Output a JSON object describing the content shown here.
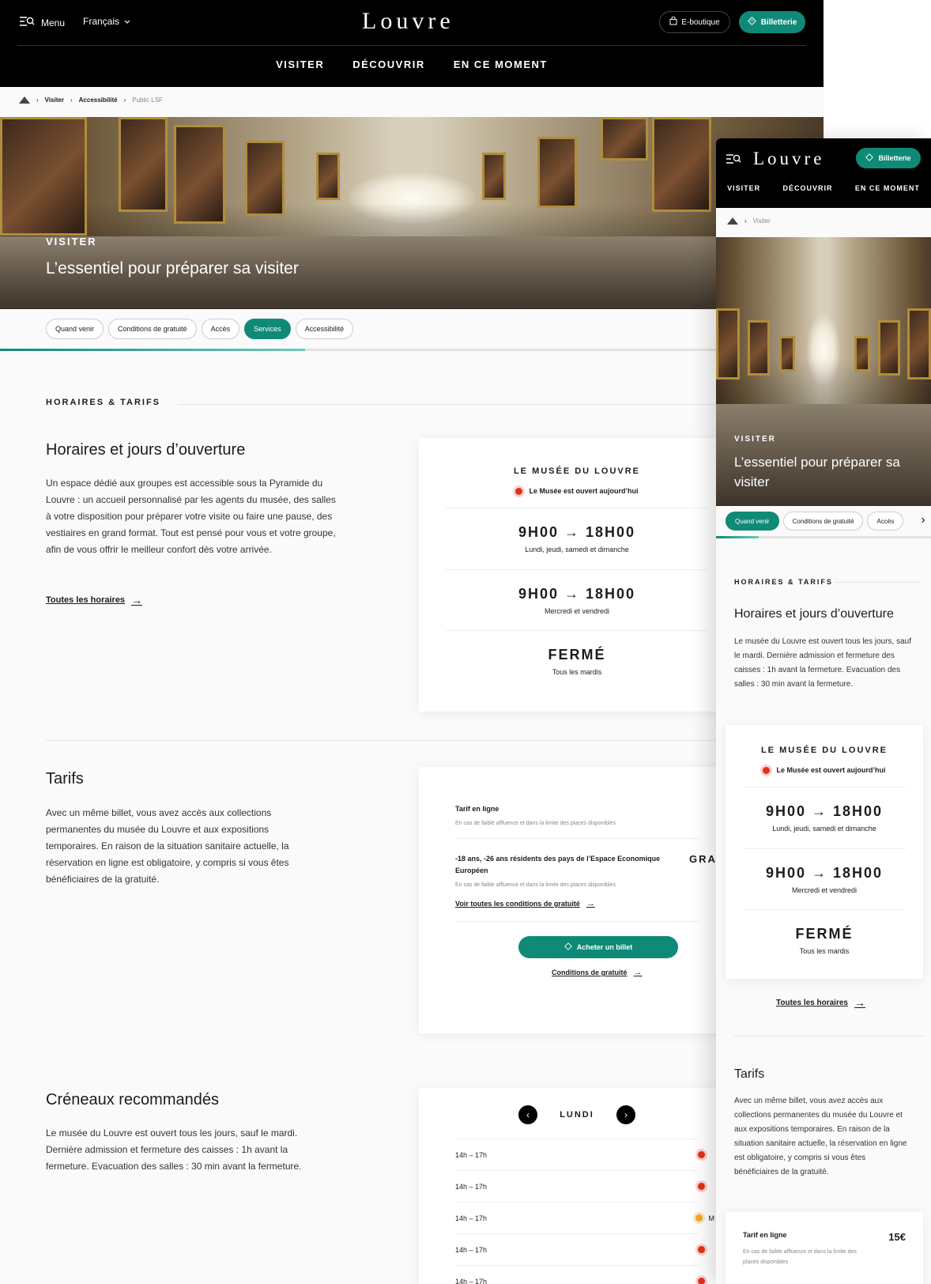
{
  "desktop": {
    "header": {
      "menu": "Menu",
      "language": "Français",
      "logo": "Louvre",
      "shop": "E-boutique",
      "tickets": "Billetterie"
    },
    "nav": [
      "VISITER",
      "DÉCOUVRIR",
      "EN CE MOMENT"
    ],
    "breadcrumb": {
      "items": [
        "Visiter",
        "Accessibilité"
      ],
      "current": "Public LSF"
    },
    "hero": {
      "eyebrow": "VISITER",
      "title": "L’essentiel pour préparer sa visiter"
    },
    "tabs": [
      {
        "label": "Quand venir",
        "active": false
      },
      {
        "label": "Conditions de gratuité",
        "active": false
      },
      {
        "label": "Accès",
        "active": false
      },
      {
        "label": "Services",
        "active": true
      },
      {
        "label": "Accessibilité",
        "active": false
      }
    ],
    "tabs_progress": 0.37,
    "section_title": "HORAIRES & TARIFS",
    "horaires": {
      "title": "Horaires et jours d’ouverture",
      "text": "Un espace dédié aux groupes est accessible sous la Pyramide du Louvre : un accueil personnalisé par les agents du musée, des salles à votre disposition pour préparer votre visite ou faire une pause, des vestiaires en grand format. Tout est pensé pour vous et votre groupe, afin de vous offrir le meilleur confort dès votre arrivée.",
      "link": "Toutes les horaires"
    },
    "museum_card": {
      "title": "LE MUSÉE DU LOUVRE",
      "status": "Le Musée est ouvert aujourd’hui",
      "rows": [
        {
          "time": "9H00 → 18H00",
          "days": "Lundi, jeudi, samedi et dimanche"
        },
        {
          "time": "9H00 → 18H00",
          "days": "Mercredi et vendredi"
        },
        {
          "time": "FERMÉ",
          "days": "Tous les mardis"
        }
      ]
    },
    "tarifs": {
      "title": "Tarifs",
      "text": "Avec un même billet, vous avez accès aux collections permanentes du musée du Louvre et aux expositions temporaires. En raison de la situation sanitaire actuelle, la réservation en ligne est obligatoire, y compris si vous êtes bénéficiaires de la gratuité.",
      "rows": [
        {
          "label": "Tarif en ligne",
          "sub": "En cas de faible affluence et dans la limite des places disponibles"
        },
        {
          "label": "-18 ans, -26 ans résidents des pays de l’Espace Economique Européen",
          "sub": "En cas de faible affluence et dans la limite des places disponibles",
          "price": "GRAT"
        }
      ],
      "conditions_link": "Voir toutes les conditions de gratuité",
      "buy": "Acheter un billet",
      "gratuite_link": "Conditions de gratuité"
    },
    "creneaux": {
      "title": "Créneaux recommandés",
      "text": "Le musée du Louvre est ouvert tous les jours, sauf le mardi. Dernière admission et fermeture des caisses : 1h avant la fermeture. Evacuation des salles : 30 min avant la fermeture.",
      "day": "LUNDI",
      "slots": [
        {
          "time": "14h – 17h",
          "status": "red"
        },
        {
          "time": "14h – 17h",
          "status": "red"
        },
        {
          "time": "14h – 17h",
          "status": "orange",
          "label": "M"
        },
        {
          "time": "14h – 17h",
          "status": "red"
        },
        {
          "time": "14h – 17h",
          "status": "red"
        }
      ]
    }
  },
  "mobile": {
    "header": {
      "logo": "Louvre",
      "tickets": "Billetterie"
    },
    "nav": [
      "VISITER",
      "DÉCOUVRIR",
      "EN CE MOMENT"
    ],
    "breadcrumb": {
      "current": "Visiter"
    },
    "hero": {
      "eyebrow": "VISITER",
      "title": "L’essentiel pour préparer sa visiter"
    },
    "tabs": [
      {
        "label": "Quand venir",
        "active": true
      },
      {
        "label": "Conditions de gratuité",
        "active": false
      },
      {
        "label": "Accès",
        "active": false
      }
    ],
    "tabs_progress": 0.2,
    "section_title": "HORAIRES & TARIFS",
    "horaires": {
      "title": "Horaires et jours d’ouverture",
      "text": "Le musée du Louvre est ouvert tous les jours, sauf le mardi. Dernière admission et fermeture des caisses : 1h avant la fermeture. Evacuation des salles : 30 min avant la fermeture.",
      "link": "Toutes les horaires"
    },
    "museum_card": {
      "title": "LE MUSÉE DU LOUVRE",
      "status": "Le Musée est ouvert aujourd’hui",
      "rows": [
        {
          "time": "9H00 → 18H00",
          "days": "Lundi, jeudi, samedi et dimanche"
        },
        {
          "time": "9H00 → 18H00",
          "days": "Mercredi et vendredi"
        },
        {
          "time": "FERMÉ",
          "days": "Tous les mardis"
        }
      ]
    },
    "tarifs": {
      "title": "Tarifs",
      "text": "Avec un même billet, vous avez accès aux collections permanentes du musée du Louvre et aux expositions temporaires. En raison de la situation sanitaire actuelle, la réservation en ligne est obligatoire, y compris si vous êtes bénéficiaires de la gratuité.",
      "row": {
        "label": "Tarif en ligne",
        "sub": "En cas de faible affluence et dans la limite des places disponibles",
        "price": "15€"
      }
    }
  }
}
